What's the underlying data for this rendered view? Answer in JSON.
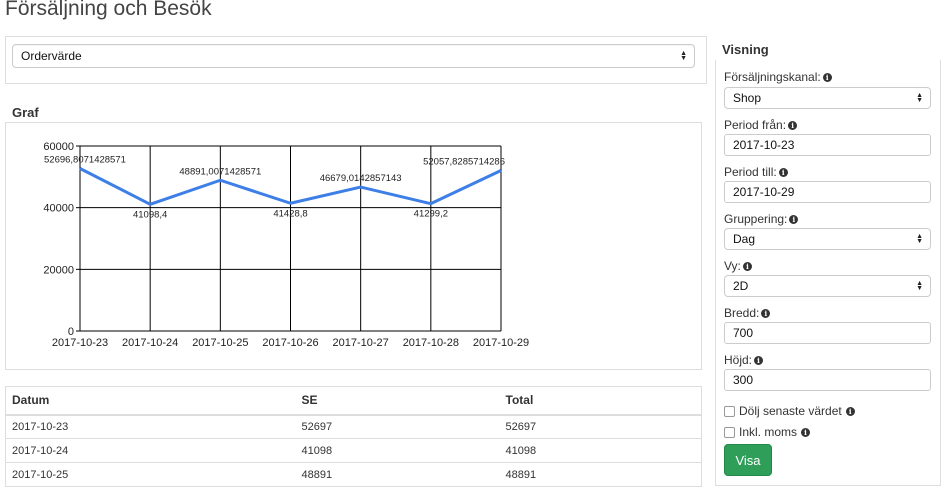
{
  "page": {
    "title": "Försäljning och Besök"
  },
  "metric_select": {
    "value": "Ordervärde"
  },
  "graph": {
    "heading": "Graf"
  },
  "chart_data": {
    "type": "line",
    "categories": [
      "2017-10-23",
      "2017-10-24",
      "2017-10-25",
      "2017-10-26",
      "2017-10-27",
      "2017-10-28",
      "2017-10-29"
    ],
    "series": [
      {
        "values": [
          52696.8071428571,
          41098.4,
          48891.0071428571,
          41428.8,
          46679.0142857143,
          41299.2,
          52057.8285714286
        ],
        "labels": [
          "52696,8071428571",
          "41098,4",
          "48891,0071428571",
          "41428,8",
          "46679,0142857143",
          "41299,2",
          "52057,8285714286"
        ]
      }
    ],
    "yticks": [
      {
        "value": 0,
        "label": "0"
      },
      {
        "value": 20000,
        "label": "20000"
      },
      {
        "value": 40000,
        "label": "40000"
      },
      {
        "value": 60000,
        "label": "60000"
      }
    ],
    "ylim": [
      0,
      60000
    ],
    "grid": true,
    "line_color": "#3d7fe6"
  },
  "table": {
    "headers": [
      "Datum",
      "SE",
      "Total"
    ],
    "rows": [
      [
        "2017-10-23",
        "52697",
        "52697"
      ],
      [
        "2017-10-24",
        "41098",
        "41098"
      ],
      [
        "2017-10-25",
        "48891",
        "48891"
      ]
    ]
  },
  "sidebar": {
    "heading": "Visning",
    "channel_label": "Försäljningskanal:",
    "channel_value": "Shop",
    "from_label": "Period från:",
    "from_value": "2017-10-23",
    "to_label": "Period till:",
    "to_value": "2017-10-29",
    "grouping_label": "Gruppering:",
    "grouping_value": "Dag",
    "view_label": "Vy:",
    "view_value": "2D",
    "width_label": "Bredd:",
    "width_value": "700",
    "height_label": "Höjd:",
    "height_value": "300",
    "hide_last_label": "Dölj senaste värdet",
    "incl_vat_label": "Inkl. moms",
    "show_button": "Visa",
    "info_glyph": "i"
  },
  "colors": {
    "accent_button": "#2e9e59",
    "line": "#3d7fe6"
  }
}
